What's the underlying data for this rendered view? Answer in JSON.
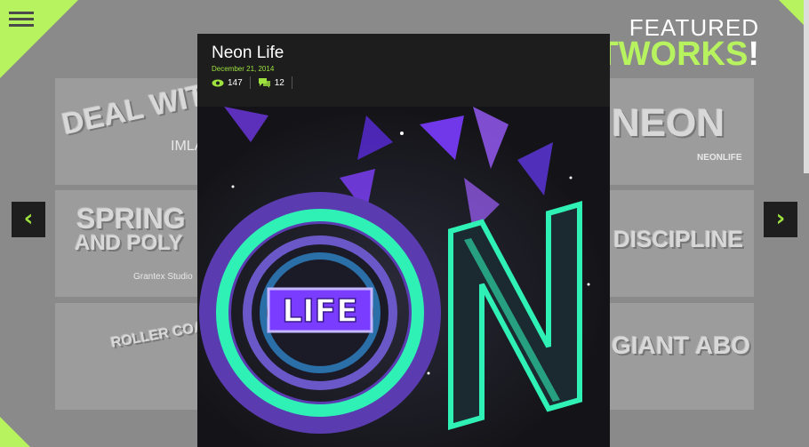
{
  "featured": {
    "line1": "FEATURED",
    "line2": "ARTWORKS",
    "excl": "!"
  },
  "thumbs": {
    "t1_main": "DEAL WITH IT",
    "t1_sub": "IMLA",
    "t2_main1": "SPRING",
    "t2_main2": "AND POLY",
    "t2_sub": "Grantex Studio",
    "t3_main": "ROLLER COASTER",
    "r1_main": "NEON",
    "r1_sub": "NEONLIFE",
    "r2_main": "DISCIPLINE",
    "r3_main": "GIANT ABO"
  },
  "modal": {
    "title": "Neon Life",
    "date": "December 21, 2014",
    "views": "147",
    "comments": "12"
  },
  "artwork": {
    "main_letters": "ON",
    "badge": "LIFE"
  },
  "colors": {
    "accent": "#b7f35f",
    "panel": "#1d1d1d",
    "neon": "#2ff0b5",
    "purple": "#7a3cff"
  }
}
